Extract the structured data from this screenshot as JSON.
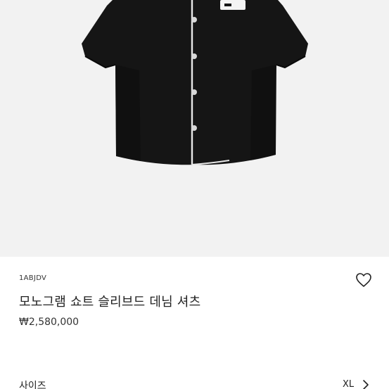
{
  "product": {
    "sku": "1ABJDV",
    "name": "모노그램 쇼트 슬리브드 데님 셔츠",
    "price": "₩2,580,000"
  },
  "size_selector": {
    "label": "사이즈",
    "value": "XL"
  },
  "icons": {
    "wishlist": "heart-outline-icon",
    "size_arrow": "chevron-right-icon"
  },
  "colors": {
    "image_background": "#f2f2f2",
    "shirt": "#151515",
    "piping": "#e8e8e8"
  }
}
